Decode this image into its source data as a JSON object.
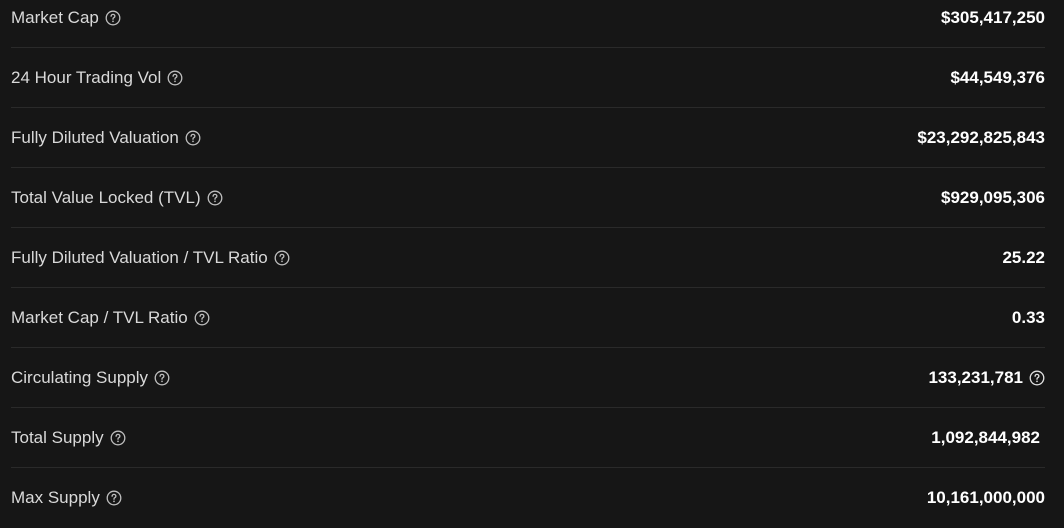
{
  "stats": [
    {
      "label": "Market Cap",
      "value": "$305,417,250",
      "value_help": false
    },
    {
      "label": "24 Hour Trading Vol",
      "value": "$44,549,376",
      "value_help": false
    },
    {
      "label": "Fully Diluted Valuation",
      "value": "$23,292,825,843",
      "value_help": false
    },
    {
      "label": "Total Value Locked (TVL)",
      "value": "$929,095,306",
      "value_help": false
    },
    {
      "label": "Fully Diluted Valuation / TVL Ratio",
      "value": "25.22",
      "value_help": false
    },
    {
      "label": "Market Cap / TVL Ratio",
      "value": "0.33",
      "value_help": false
    },
    {
      "label": "Circulating Supply",
      "value": "133,231,781",
      "value_help": true
    },
    {
      "label": "Total Supply",
      "value": "1,092,844,982",
      "value_help": false
    },
    {
      "label": "Max Supply",
      "value": "10,161,000,000",
      "value_help": false
    }
  ],
  "colors": {
    "background": "#161616",
    "divider": "#2a2a2a",
    "label_text": "#d9d9d9",
    "value_text": "#ffffff"
  },
  "icons": {
    "help": "question-circle-icon"
  }
}
